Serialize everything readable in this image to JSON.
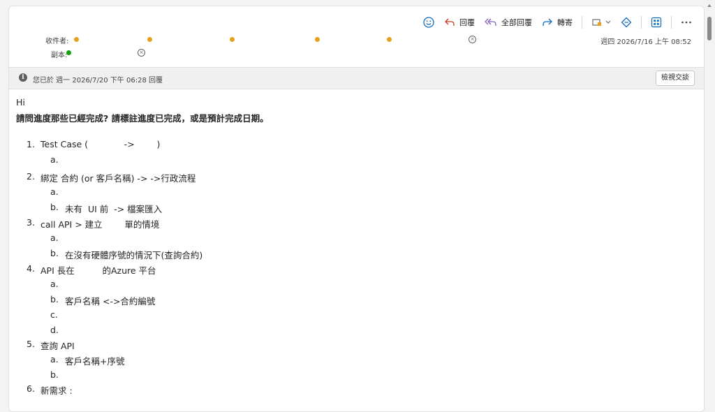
{
  "toolbar": {
    "reply_label": "回覆",
    "reply_all_label": "全部回覆",
    "forward_label": "轉寄"
  },
  "header": {
    "to_label": "收件者:",
    "cc_label": "副本:",
    "date": "週四 2026/7/16 上午 08:52"
  },
  "infobar": {
    "text": "您已於 週一 2026/7/20 下午 06:28 回覆",
    "view_button": "檢視交談"
  },
  "message": {
    "greeting": "Hi",
    "intro": "請問進度那些已經完成? 請標註進度已完成，或是預計完成日期。",
    "items": [
      {
        "num": "1.",
        "text": "Test Case (             ->        )"
      },
      {
        "num": "a.",
        "text": ""
      },
      {
        "num": "2.",
        "text": "綁定 合約 (or 客戶名稱) -> ->行政流程"
      },
      {
        "num": "a.",
        "text": ""
      },
      {
        "num": "b.",
        "text": "未有  UI 前  -> 檔案匯入"
      },
      {
        "num": "3.",
        "text": "call API > 建立        單的情境"
      },
      {
        "num": "a.",
        "text": ""
      },
      {
        "num": "b.",
        "text": "在沒有硬體序號的情況下(查詢合約)"
      },
      {
        "num": "4.",
        "text": "API 長在          的Azure 平台"
      },
      {
        "num": "a.",
        "text": ""
      },
      {
        "num": "b.",
        "text": "客戶名稱 <->合約編號"
      },
      {
        "num": "c.",
        "text": ""
      },
      {
        "num": "d.",
        "text": ""
      },
      {
        "num": "5.",
        "text": "查詢 API"
      },
      {
        "num": "a.",
        "text": "客戶名稱+序號"
      },
      {
        "num": "b.",
        "text": ""
      },
      {
        "num": "6.",
        "text": "新需求 :"
      }
    ]
  }
}
